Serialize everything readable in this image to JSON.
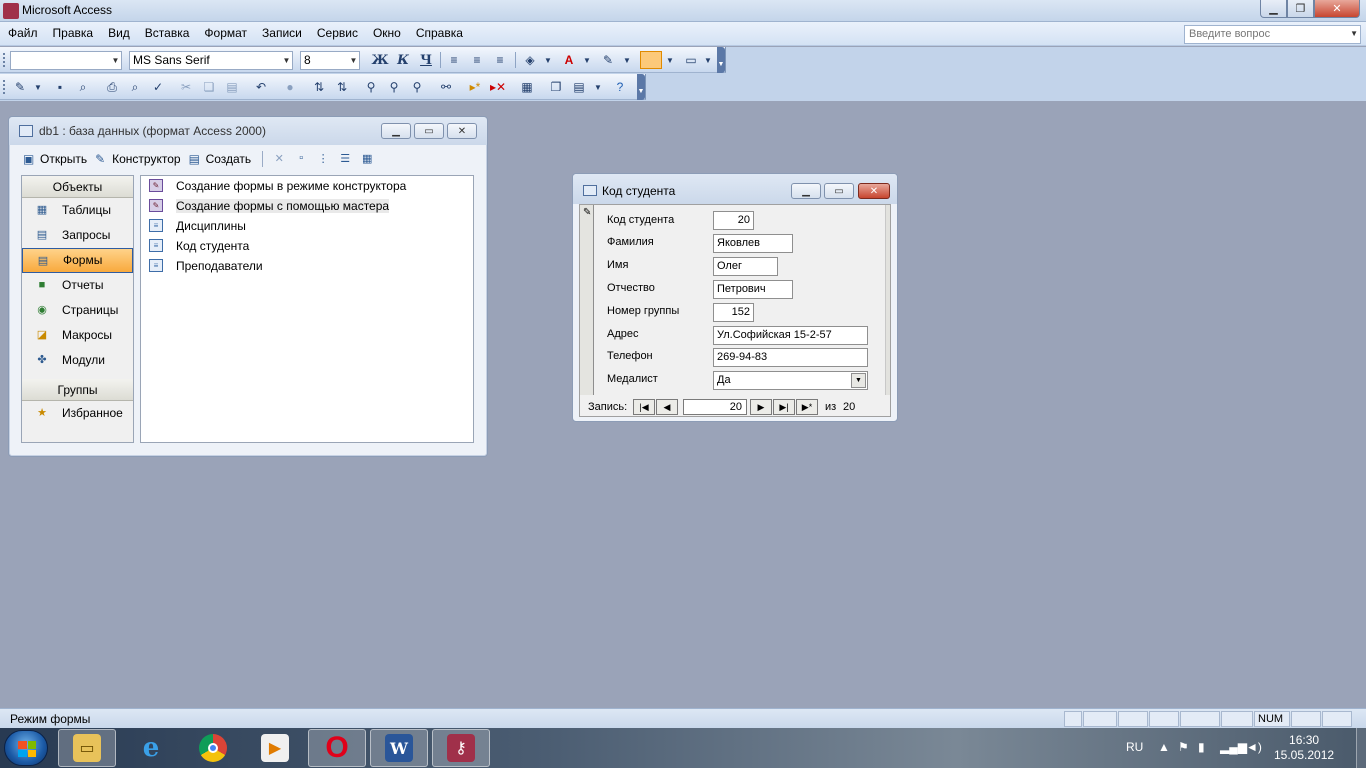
{
  "app": {
    "title": "Microsoft Access"
  },
  "menu": [
    "Файл",
    "Правка",
    "Вид",
    "Вставка",
    "Формат",
    "Записи",
    "Сервис",
    "Окно",
    "Справка"
  ],
  "ask_placeholder": "Введите вопрос",
  "formatting_toolbar": {
    "object_combo": "",
    "font": "MS Sans Serif",
    "size": "8",
    "bold": "Ж",
    "italic": "К",
    "underline": "Ч"
  },
  "db_window": {
    "title": "db1 : база данных (формат Access 2000)",
    "toolbar": {
      "open": "Открыть",
      "design": "Конструктор",
      "create": "Создать"
    },
    "objects_header": "Объекты",
    "objects": [
      "Таблицы",
      "Запросы",
      "Формы",
      "Отчеты",
      "Страницы",
      "Макросы",
      "Модули"
    ],
    "selected_object": "Формы",
    "groups_header": "Группы",
    "groups": [
      "Избранное"
    ],
    "items": [
      "Создание формы в режиме конструктора",
      "Создание формы с помощью мастера",
      "Дисциплины",
      "Код студента",
      "Преподаватели"
    ]
  },
  "form_window": {
    "title": "Код студента",
    "fields": [
      {
        "label": "Код студента",
        "value": "20"
      },
      {
        "label": "Фамилия",
        "value": "Яковлев"
      },
      {
        "label": "Имя",
        "value": "Олег"
      },
      {
        "label": "Отчество",
        "value": "Петрович"
      },
      {
        "label": "Номер группы",
        "value": "152"
      },
      {
        "label": "Адрес",
        "value": "Ул.Софийская 15-2-57"
      },
      {
        "label": "Телефон",
        "value": "269-94-83"
      },
      {
        "label": "Медалист",
        "value": "Да"
      }
    ],
    "nav": {
      "label": "Запись:",
      "current": "20",
      "of_label": "из",
      "total": "20"
    }
  },
  "status": {
    "text": "Режим формы",
    "num": "NUM"
  },
  "taskbar": {
    "lang": "RU",
    "time": "16:30",
    "date": "15.05.2012"
  },
  "colors": {
    "selected_object": "#f8a93d",
    "workspace": "#9aa3b8",
    "close_button": "#c7452f"
  }
}
